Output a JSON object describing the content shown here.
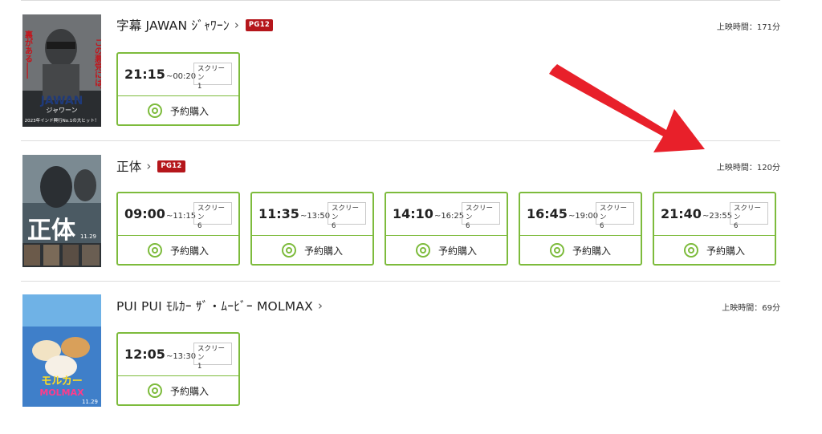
{
  "films": [
    {
      "title": "字幕 JAWAN ｼﾞｬﾜｰﾝ",
      "rating": "PG12",
      "runtime": "上映時間：171分",
      "poster_text": [
        "この悪党には、",
        "裏がある――",
        "JAWAN",
        "ジャワーン",
        "2023年インド興行No.1の大ヒット！"
      ],
      "showtimes": [
        {
          "start": "21:15",
          "end": "~00:20",
          "screen_label": "スクリーン",
          "screen_no": "1",
          "buy_label": "予約購入"
        }
      ]
    },
    {
      "title": "正体",
      "rating": "PG12",
      "runtime": "上映時間：120分",
      "poster_text": [
        "正体",
        "11.29"
      ],
      "showtimes": [
        {
          "start": "09:00",
          "end": "~11:15",
          "screen_label": "スクリーン",
          "screen_no": "6",
          "buy_label": "予約購入"
        },
        {
          "start": "11:35",
          "end": "~13:50",
          "screen_label": "スクリーン",
          "screen_no": "6",
          "buy_label": "予約購入"
        },
        {
          "start": "14:10",
          "end": "~16:25",
          "screen_label": "スクリーン",
          "screen_no": "6",
          "buy_label": "予約購入"
        },
        {
          "start": "16:45",
          "end": "~19:00",
          "screen_label": "スクリーン",
          "screen_no": "6",
          "buy_label": "予約購入"
        },
        {
          "start": "21:40",
          "end": "~23:55",
          "screen_label": "スクリーン",
          "screen_no": "6",
          "buy_label": "予約購入"
        }
      ]
    },
    {
      "title": "PUI PUI ﾓﾙｶｰ ｻﾞ・ﾑｰﾋﾞｰ MOLMAX",
      "rating": "",
      "runtime": "上映時間：69分",
      "poster_text": [
        "モルカー",
        "MOLMAX",
        "11.29"
      ],
      "showtimes": [
        {
          "start": "12:05",
          "end": "~13:30",
          "screen_label": "スクリーン",
          "screen_no": "1",
          "buy_label": "予約購入"
        }
      ]
    }
  ],
  "colors": {
    "accent_green": "#7dbb3c",
    "rating_red": "#b5161b",
    "arrow_red": "#e8202a",
    "divider": "#dcdcdc"
  },
  "icons": {
    "title_link": "chevron-right-icon",
    "buy": "double-circle-icon",
    "annotation": "red-arrow-annotation"
  }
}
